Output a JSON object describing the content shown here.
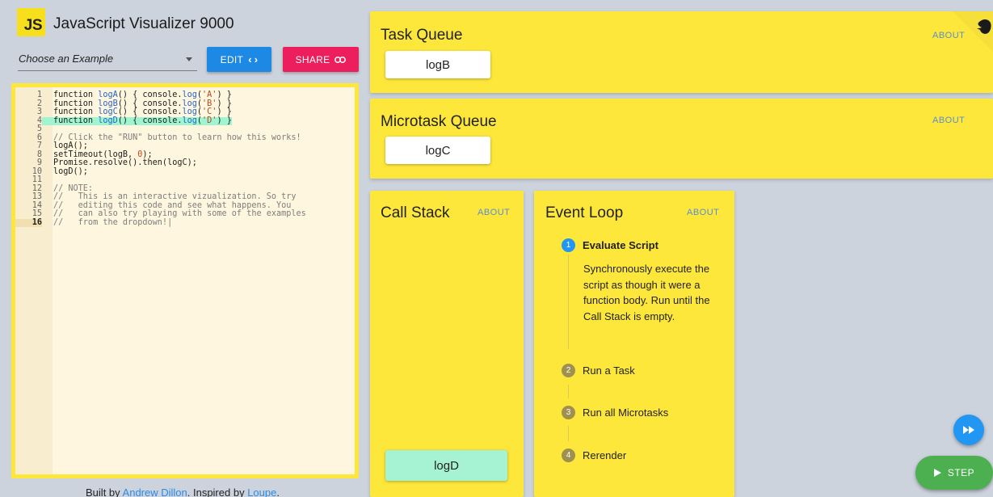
{
  "app": {
    "logo_text": "JS",
    "title": "JavaScript Visualizer 9000"
  },
  "toolbar": {
    "example_select": {
      "value": "Choose an Example"
    },
    "edit_label": "EDIT",
    "share_label": "SHARE"
  },
  "editor": {
    "lines": [
      {
        "n": "1",
        "text": "function logA() { console.log('A') }"
      },
      {
        "n": "2",
        "text": "function logB() { console.log('B') }"
      },
      {
        "n": "3",
        "text": "function logC() { console.log('C') }"
      },
      {
        "n": "4",
        "text": "function logD() { console.log('D') }",
        "highlight": true
      },
      {
        "n": "5",
        "text": ""
      },
      {
        "n": "6",
        "text": "// Click the \"RUN\" button to learn how this works!",
        "comment": true
      },
      {
        "n": "7",
        "text": "logA();"
      },
      {
        "n": "8",
        "text": "setTimeout(logB, 0);"
      },
      {
        "n": "9",
        "text": "Promise.resolve().then(logC);"
      },
      {
        "n": "10",
        "text": "logD();"
      },
      {
        "n": "11",
        "text": ""
      },
      {
        "n": "12",
        "text": "// NOTE:",
        "comment": true
      },
      {
        "n": "13",
        "text": "//   This is an interactive vizualization. So try",
        "comment": true
      },
      {
        "n": "14",
        "text": "//   editing this code and see what happens. You",
        "comment": true
      },
      {
        "n": "15",
        "text": "//   can also try playing with some of the examples",
        "comment": true
      },
      {
        "n": "16",
        "text": "//   from the dropdown!|",
        "comment": true,
        "active": true
      }
    ]
  },
  "footer": {
    "prefix": "Built by ",
    "author": "Andrew Dillon",
    "middle": ". Inspired by ",
    "inspired": "Loupe",
    "suffix": "."
  },
  "task_queue": {
    "title": "Task Queue",
    "about": "ABOUT",
    "items": [
      "logB"
    ]
  },
  "microtask_queue": {
    "title": "Microtask Queue",
    "about": "ABOUT",
    "items": [
      "logC"
    ]
  },
  "call_stack": {
    "title": "Call Stack",
    "about": "ABOUT",
    "items": [
      "logD"
    ]
  },
  "event_loop": {
    "title": "Event Loop",
    "about": "ABOUT",
    "steps": [
      {
        "num": "1",
        "label": "Evaluate Script",
        "active": true,
        "description": "Synchronously execute the script as though it were a function body. Run until the Call Stack is empty."
      },
      {
        "num": "2",
        "label": "Run a Task"
      },
      {
        "num": "3",
        "label": "Run all Microtasks"
      },
      {
        "num": "4",
        "label": "Rerender"
      }
    ]
  },
  "controls": {
    "step_label": "STEP"
  },
  "colors": {
    "panel_yellow": "#fde73a",
    "accent_blue": "#1e88e5",
    "accent_pink": "#ec1e5d",
    "step_green": "#4caf50",
    "stack_chip": "#a6f3d4"
  }
}
